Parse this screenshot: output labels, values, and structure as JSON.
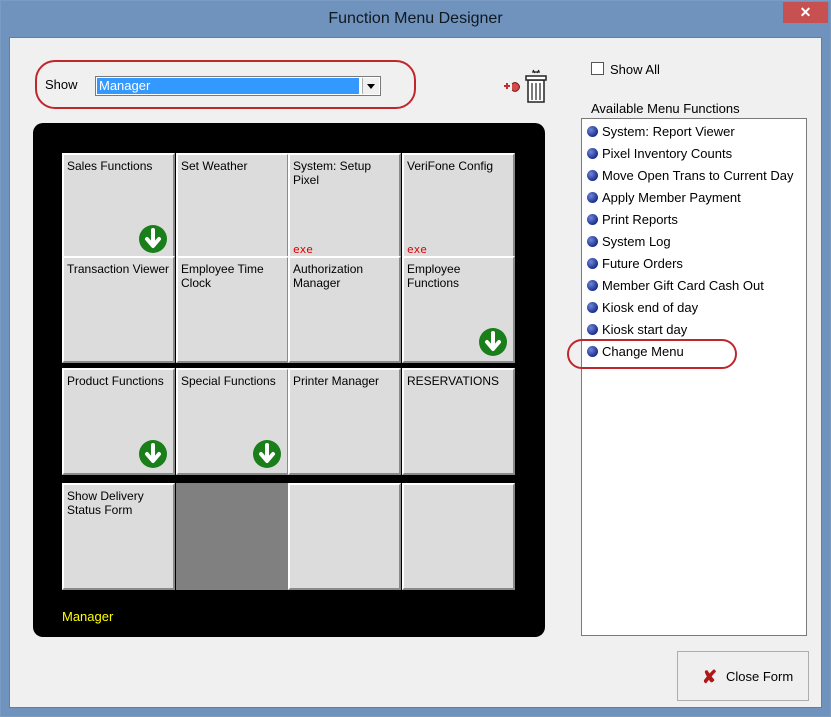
{
  "window": {
    "title": "Function Menu Designer",
    "close_glyph": "✕"
  },
  "show": {
    "label": "Show",
    "selected": "Manager"
  },
  "grid": {
    "footer": "Manager",
    "tiles": [
      {
        "label": "Sales Functions",
        "badge": "",
        "arrow": true
      },
      {
        "label": "Set Weather",
        "badge": "",
        "arrow": false
      },
      {
        "label": "System: Setup Pixel",
        "badge": "exe",
        "arrow": false
      },
      {
        "label": "VeriFone Config",
        "badge": "exe",
        "arrow": false
      },
      {
        "label": "Transaction Viewer",
        "badge": "",
        "arrow": false
      },
      {
        "label": "Employee Time Clock",
        "badge": "",
        "arrow": false
      },
      {
        "label": "Authorization Manager",
        "badge": "",
        "arrow": false
      },
      {
        "label": "Employee Functions",
        "badge": "",
        "arrow": true
      },
      {
        "label": "Product Functions",
        "badge": "",
        "arrow": true
      },
      {
        "label": "Special Functions",
        "badge": "",
        "arrow": true
      },
      {
        "label": "Printer Manager",
        "badge": "",
        "arrow": false
      },
      {
        "label": "RESERVATIONS",
        "badge": "",
        "arrow": false
      },
      {
        "label": "Show Delivery Status Form",
        "badge": "",
        "arrow": false
      },
      {
        "label": "",
        "badge": "",
        "arrow": false,
        "selected": true
      },
      {
        "label": "",
        "badge": "",
        "arrow": false
      },
      {
        "label": "",
        "badge": "",
        "arrow": false
      }
    ]
  },
  "right": {
    "show_all_label": "Show All",
    "available_label": "Available Menu Functions",
    "functions": [
      "System: Report Viewer",
      "Pixel Inventory Counts",
      "Move Open Trans to Current Day",
      "Apply Member Payment",
      "Print Reports",
      "System Log",
      "Future Orders",
      "Member Gift Card Cash Out",
      "Kiosk end of day",
      "Kiosk start day",
      "Change Menu"
    ]
  },
  "buttons": {
    "close_label": "Close Form",
    "close_icon": "✘"
  },
  "colors": {
    "title_bar": "#6f93bd",
    "highlight_oval": "#c0272d",
    "arrow_badge": "#1a7f1a",
    "exe_text": "#e00000",
    "footer_text": "#ffff00"
  }
}
